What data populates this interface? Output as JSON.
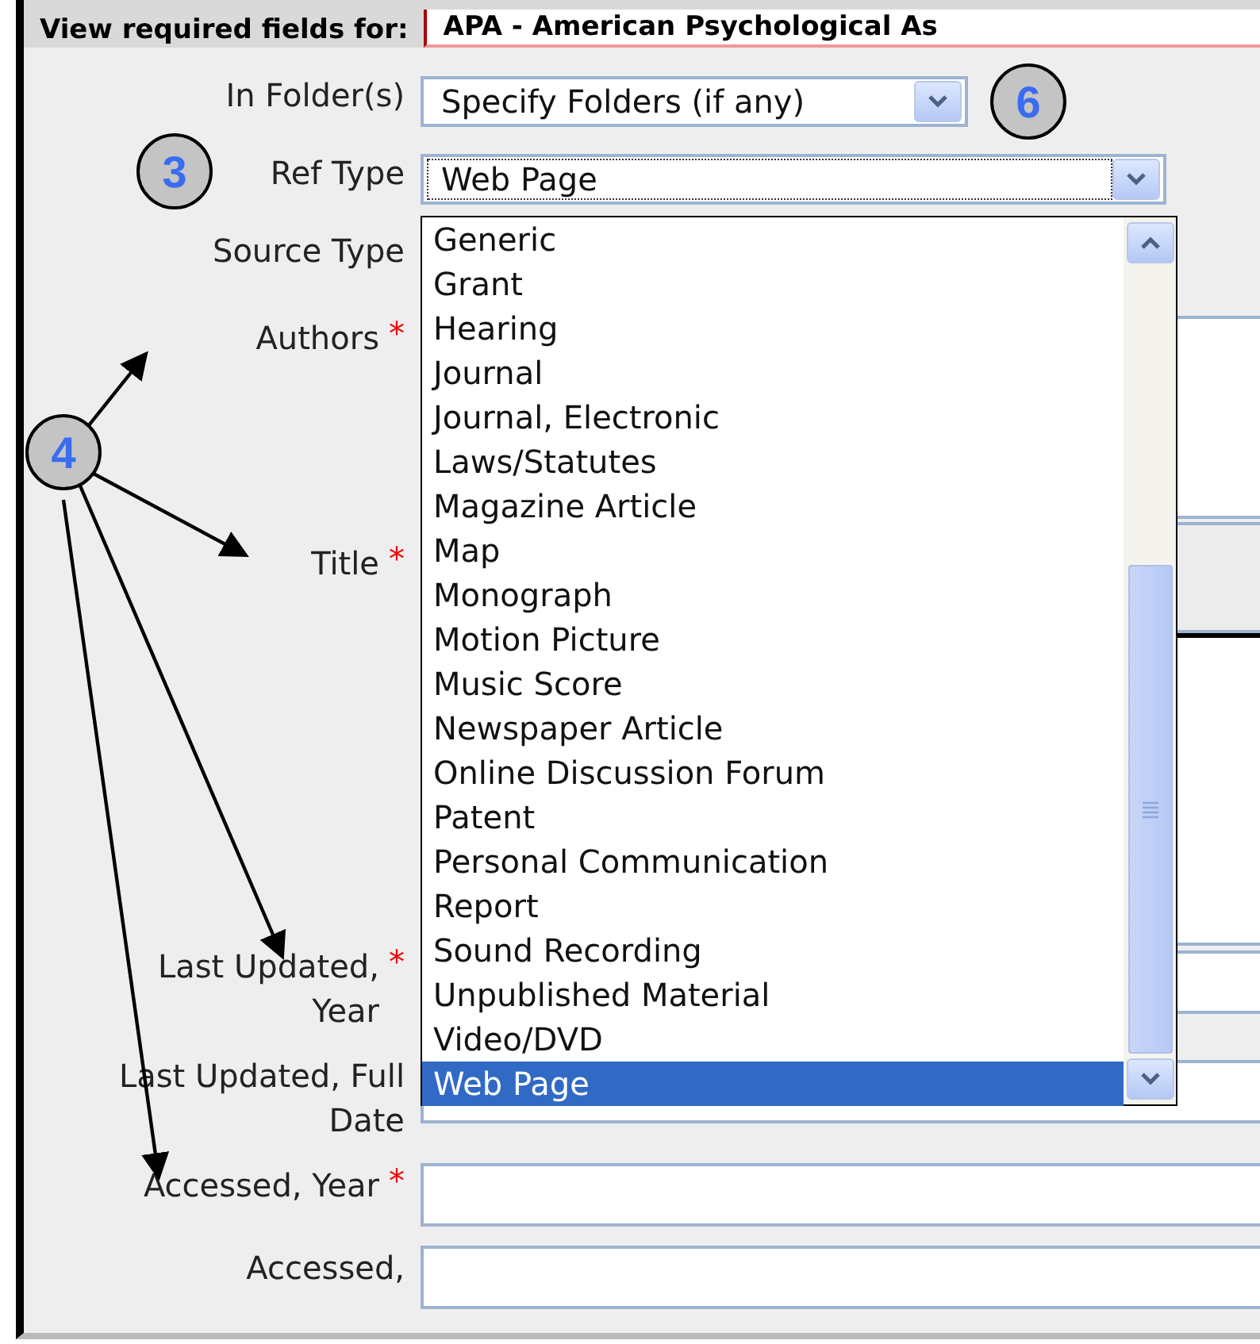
{
  "header": {
    "label": "View required fields for:",
    "value": "APA - American Psychological As"
  },
  "fields": [
    {
      "label": "In Folder(s)",
      "kind": "select",
      "value": "Specify Folders (if any)"
    },
    {
      "label": "Ref Type",
      "kind": "select",
      "value": "Web Page",
      "focused": true
    },
    {
      "label": "Source Type",
      "kind": "blank"
    },
    {
      "label": "Authors",
      "required_mark": "*",
      "kind": "area"
    },
    {
      "label": "Title",
      "required_mark": "*",
      "kind": "toolbar"
    },
    {
      "kind": "editor"
    },
    {
      "label": "Last Updated, Year",
      "required_mark": "*",
      "kind": "text"
    },
    {
      "label": "Last Updated, Full Date",
      "kind": "text"
    },
    {
      "label": "Accessed, Year",
      "required_mark": "*",
      "kind": "text"
    },
    {
      "label": "Accessed,",
      "kind": "text"
    }
  ],
  "dropdown": {
    "items": [
      {
        "label": "Generic",
        "selected": false
      },
      {
        "label": "Grant",
        "selected": false
      },
      {
        "label": "Hearing",
        "selected": false
      },
      {
        "label": "Journal",
        "selected": false
      },
      {
        "label": "Journal, Electronic",
        "selected": false
      },
      {
        "label": "Laws/Statutes",
        "selected": false
      },
      {
        "label": "Magazine Article",
        "selected": false
      },
      {
        "label": "Map",
        "selected": false
      },
      {
        "label": "Monograph",
        "selected": false
      },
      {
        "label": "Motion Picture",
        "selected": false
      },
      {
        "label": "Music Score",
        "selected": false
      },
      {
        "label": "Newspaper Article",
        "selected": false
      },
      {
        "label": "Online Discussion Forum",
        "selected": false
      },
      {
        "label": "Patent",
        "selected": false
      },
      {
        "label": "Personal Communication",
        "selected": false
      },
      {
        "label": "Report",
        "selected": false
      },
      {
        "label": "Sound Recording",
        "selected": false
      },
      {
        "label": "Unpublished Material",
        "selected": false
      },
      {
        "label": "Video/DVD",
        "selected": false
      },
      {
        "label": "Web Page",
        "selected": true
      }
    ]
  },
  "annotations": [
    {
      "number": "6"
    },
    {
      "number": "3"
    },
    {
      "number": "4"
    }
  ]
}
